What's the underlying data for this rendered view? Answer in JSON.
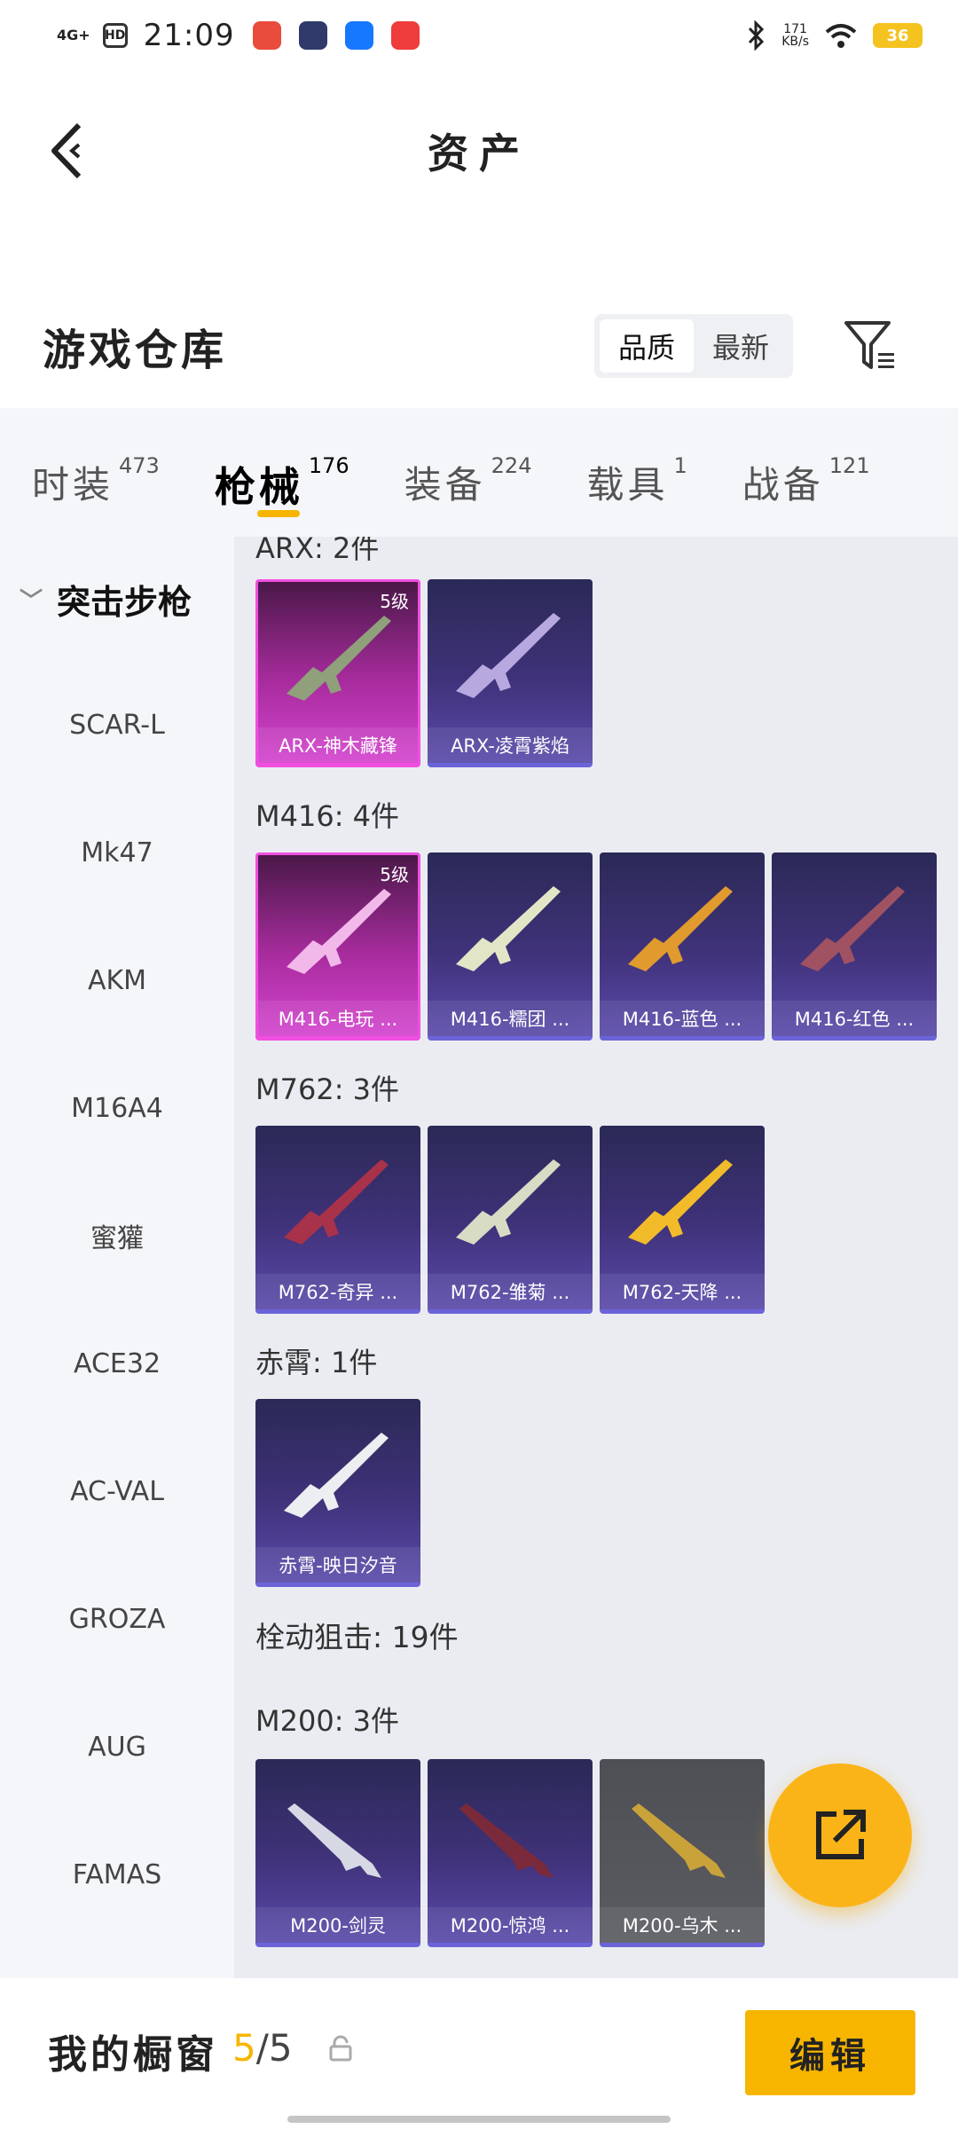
{
  "status_bar": {
    "network": "4G+",
    "hd": "HD",
    "time": "21:09",
    "speed_value": "171",
    "speed_unit": "KB/s",
    "battery": "36"
  },
  "header": {
    "title": "资产"
  },
  "warehouse": {
    "title": "游戏仓库",
    "sort_options": [
      "品质",
      "最新"
    ],
    "active_sort": "品质"
  },
  "tabs": [
    {
      "label": "时装",
      "count": "473"
    },
    {
      "label": "枪械",
      "count": "176",
      "active": true
    },
    {
      "label": "装备",
      "count": "224"
    },
    {
      "label": "载具",
      "count": "1"
    },
    {
      "label": "战备",
      "count": "121"
    }
  ],
  "sidebar": {
    "category": "突击步枪",
    "items": [
      "SCAR-L",
      "Mk47",
      "AKM",
      "M16A4",
      "蜜獾",
      "ACE32",
      "AC-VAL",
      "GROZA",
      "AUG",
      "FAMAS"
    ]
  },
  "groups": [
    {
      "title": "ARX: 2件",
      "cards": [
        {
          "name": "ARX-神木藏锋",
          "level": "5级",
          "style": "purple"
        },
        {
          "name": "ARX-凌霄紫焰",
          "style": "blue"
        }
      ]
    },
    {
      "title": "M416: 4件",
      "cards": [
        {
          "name": "M416-电玩 ...",
          "level": "5级",
          "style": "purple"
        },
        {
          "name": "M416-糯团 ...",
          "style": "blue"
        },
        {
          "name": "M416-蓝色 ...",
          "style": "blue"
        },
        {
          "name": "M416-红色 ...",
          "style": "blue"
        }
      ]
    },
    {
      "title": "M762: 3件",
      "cards": [
        {
          "name": "M762-奇异 ...",
          "style": "blue"
        },
        {
          "name": "M762-雏菊 ...",
          "style": "blue"
        },
        {
          "name": "M762-天降 ...",
          "style": "blue"
        }
      ]
    },
    {
      "title": "赤霄: 1件",
      "cards": [
        {
          "name": "赤霄-映日汐音",
          "style": "blue"
        }
      ]
    },
    {
      "title": "栓动狙击: 19件",
      "cards": []
    },
    {
      "title": "M200: 3件",
      "cards": [
        {
          "name": "M200-剑灵",
          "style": "blue"
        },
        {
          "name": "M200-惊鸿 ...",
          "style": "blue"
        },
        {
          "name": "M200-乌木 ...",
          "style": "gray"
        }
      ]
    }
  ],
  "bottom_bar": {
    "title": "我的橱窗",
    "count_current": "5",
    "count_separator": "/",
    "count_total": "5",
    "edit_label": "编辑"
  },
  "colors": {
    "accent": "#f7b500",
    "card_blue": "#40327a",
    "card_purple": "#d444cf"
  }
}
